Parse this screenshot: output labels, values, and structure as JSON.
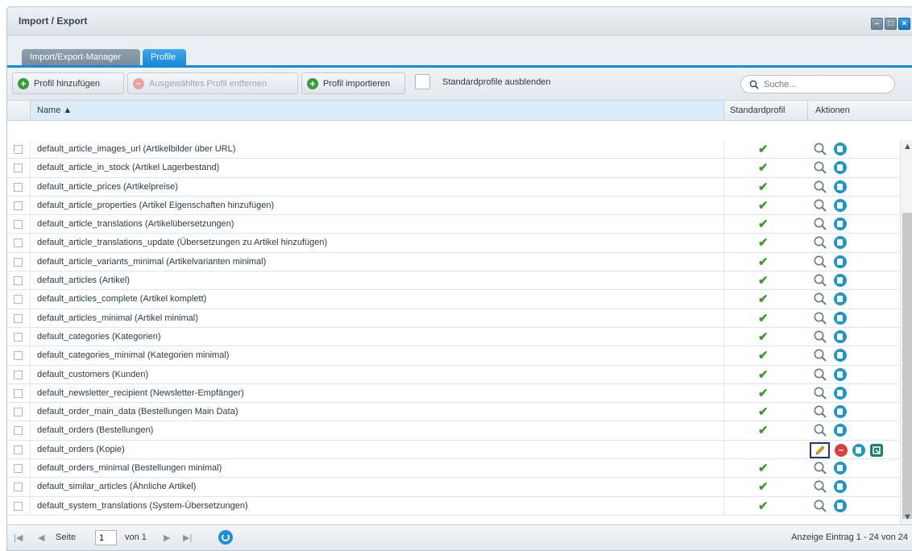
{
  "window": {
    "title": "Import / Export"
  },
  "tabs": [
    {
      "label": "Import/Export-Manager",
      "active": false
    },
    {
      "label": "Profile",
      "active": true
    }
  ],
  "toolbar": {
    "add_profile": "Profil hinzufügen",
    "remove_profile": "Ausgewähltes Profil entfernen",
    "import_profile": "Profil importieren",
    "hide_default_label": "Standardprofile ausblenden",
    "search_placeholder": "Suche..."
  },
  "grid": {
    "columns": {
      "name": "Name ▲",
      "default": "Standardprofil",
      "actions": "Aktionen"
    },
    "rows": [
      {
        "name": "default_article_images_url (Artikelbilder über URL)",
        "is_default": true
      },
      {
        "name": "default_article_in_stock (Artikel Lagerbestand)",
        "is_default": true
      },
      {
        "name": "default_article_prices (Artikelpreise)",
        "is_default": true
      },
      {
        "name": "default_article_properties (Artikel Eigenschaften hinzufügen)",
        "is_default": true
      },
      {
        "name": "default_article_translations (Artikelübersetzungen)",
        "is_default": true
      },
      {
        "name": "default_article_translations_update (Übersetzungen zu Artikel hinzufügen)",
        "is_default": true
      },
      {
        "name": "default_article_variants_minimal (Artikelvarianten minimal)",
        "is_default": true
      },
      {
        "name": "default_articles (Artikel)",
        "is_default": true
      },
      {
        "name": "default_articles_complete (Artikel komplett)",
        "is_default": true
      },
      {
        "name": "default_articles_minimal (Artikel minimal)",
        "is_default": true
      },
      {
        "name": "default_categories (Kategorien)",
        "is_default": true
      },
      {
        "name": "default_categories_minimal (Kategorien minimal)",
        "is_default": true
      },
      {
        "name": "default_customers (Kunden)",
        "is_default": true
      },
      {
        "name": "default_newsletter_recipient (Newsletter-Empfänger)",
        "is_default": true
      },
      {
        "name": "default_order_main_data (Bestellungen Main Data)",
        "is_default": true
      },
      {
        "name": "default_orders (Bestellungen)",
        "is_default": true
      },
      {
        "name": "default_orders (Kopie)",
        "is_default": false
      },
      {
        "name": "default_orders_minimal (Bestellungen minimal)",
        "is_default": true
      },
      {
        "name": "default_similar_articles (Ähnliche Artikel)",
        "is_default": true
      },
      {
        "name": "default_system_translations (System-Übersetzungen)",
        "is_default": true
      }
    ]
  },
  "pager": {
    "page_label": "Seite",
    "page_value": "1",
    "of_label": "von 1",
    "summary": "Anzeige Eintrag 1 - 24 von 24"
  },
  "colors": {
    "accent": "#1a8ad8",
    "check": "#3d9a2e",
    "header_selected": "#dcebf8"
  }
}
